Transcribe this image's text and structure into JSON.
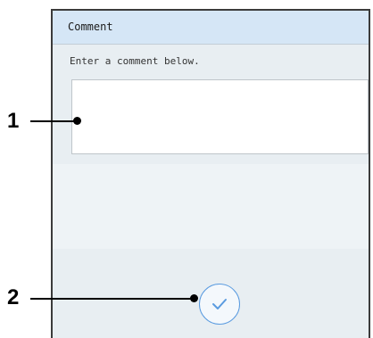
{
  "dialog": {
    "title": "Comment",
    "instruction": "Enter a comment below.",
    "comment_value": "",
    "confirm_icon": "checkmark-icon"
  },
  "callouts": {
    "one": "1",
    "two": "2"
  },
  "colors": {
    "header_bg": "#d5e6f6",
    "panel_bg": "#e8eef2",
    "accent": "#5a9be0"
  }
}
